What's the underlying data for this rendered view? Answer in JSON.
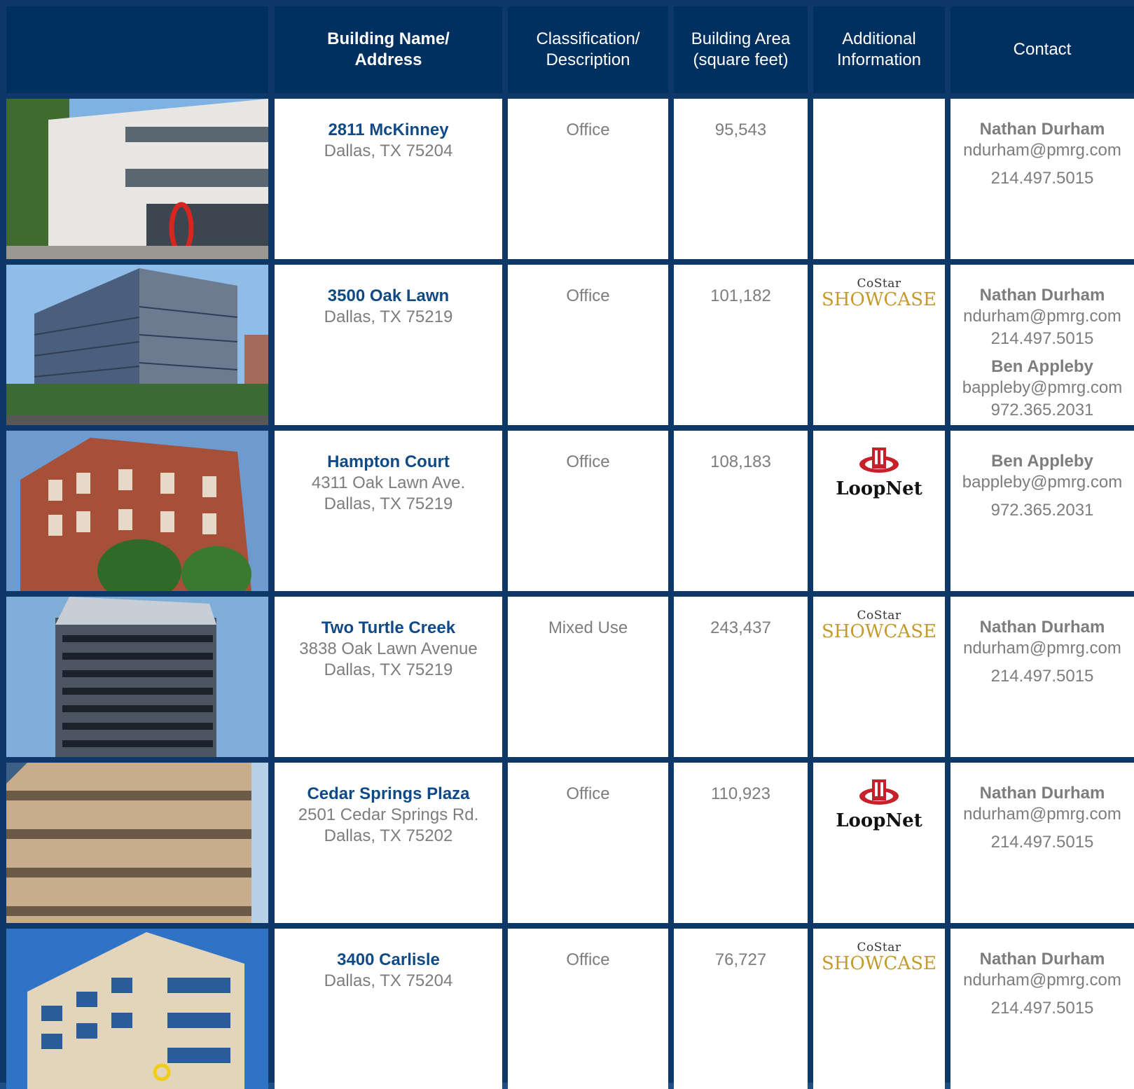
{
  "header": {
    "building": "Building Name/\nAddress",
    "classification": "Classification/\nDescription",
    "area": "Building Area\n(square feet)",
    "additional": "Additional\nInformation",
    "contact": "Contact"
  },
  "rows": [
    {
      "name": "2811 McKinney",
      "address_lines": [
        "Dallas, TX 75204"
      ],
      "classification": "Office",
      "area": "95,543",
      "logo": "",
      "contacts": [
        {
          "name": "Nathan Durham",
          "email": "ndurham@pmrg.com",
          "phone": "214.497.5015"
        }
      ]
    },
    {
      "name": "3500 Oak Lawn",
      "address_lines": [
        "Dallas, TX 75219"
      ],
      "classification": "Office",
      "area": "101,182",
      "logo": "costar-showcase",
      "contacts": [
        {
          "name": "Nathan Durham",
          "email": "ndurham@pmrg.com",
          "phone": "214.497.5015"
        },
        {
          "name": "Ben Appleby",
          "email": "bappleby@pmrg.com",
          "phone": "972.365.2031"
        }
      ]
    },
    {
      "name": "Hampton Court",
      "address_lines": [
        "4311 Oak Lawn Ave.",
        "Dallas, TX 75219"
      ],
      "classification": "Office",
      "area": "108,183",
      "logo": "loopnet",
      "contacts": [
        {
          "name": "Ben Appleby",
          "email": "bappleby@pmrg.com",
          "phone": "972.365.2031"
        }
      ]
    },
    {
      "name": "Two Turtle Creek",
      "address_lines": [
        "3838 Oak Lawn Avenue",
        "Dallas, TX 75219"
      ],
      "classification": "Mixed Use",
      "area": "243,437",
      "logo": "costar-showcase",
      "contacts": [
        {
          "name": "Nathan Durham",
          "email": "ndurham@pmrg.com",
          "phone": "214.497.5015"
        }
      ]
    },
    {
      "name": "Cedar Springs Plaza",
      "address_lines": [
        "2501 Cedar Springs Rd.",
        "Dallas, TX 75202"
      ],
      "classification": "Office",
      "area": "110,923",
      "logo": "loopnet",
      "contacts": [
        {
          "name": "Nathan Durham",
          "email": "ndurham@pmrg.com",
          "phone": "214.497.5015"
        }
      ]
    },
    {
      "name": "3400 Carlisle",
      "address_lines": [
        "Dallas, TX 75204"
      ],
      "classification": "Office",
      "area": "76,727",
      "logo": "costar-showcase",
      "contacts": [
        {
          "name": "Nathan Durham",
          "email": "ndurham@pmrg.com",
          "phone": "214.497.5015"
        }
      ]
    }
  ],
  "logos": {
    "costar_top": "CoStar",
    "costar_bottom": "SHOWCASE",
    "loopnet": "LoopNet"
  },
  "colors": {
    "header_bg": "#00305f",
    "grid": "#0d3868",
    "name": "#0f4a86",
    "body_text": "#7d7d7d",
    "costar_gold": "#c49a2a",
    "loopnet_red": "#c8202a"
  }
}
